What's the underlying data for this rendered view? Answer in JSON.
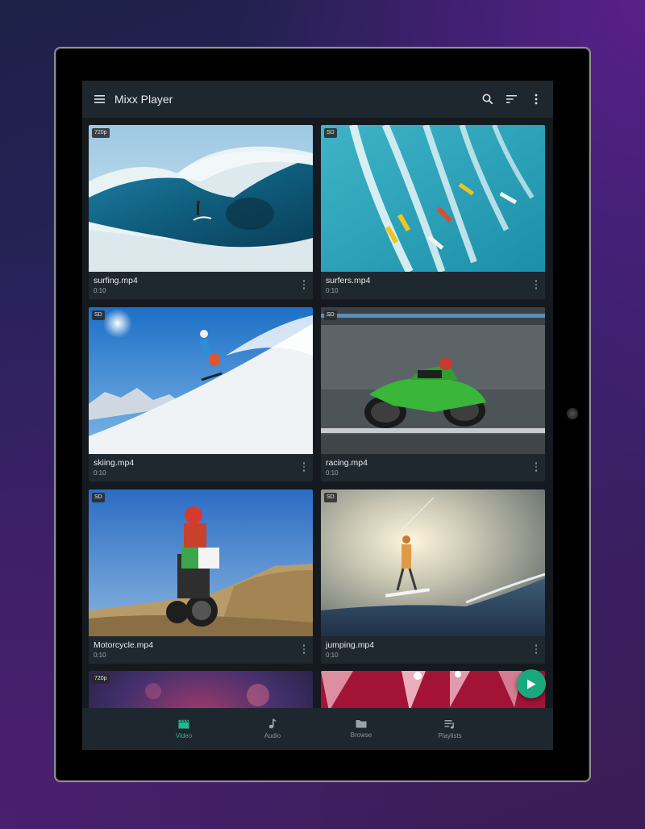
{
  "app": {
    "title": "Mixx Player"
  },
  "toolbar": {
    "icons": [
      "menu-icon",
      "search-icon",
      "sort-icon",
      "more-vert-icon"
    ]
  },
  "videos": [
    {
      "name": "surfing.mp4",
      "duration": "0:10",
      "quality": "720p",
      "scene": "wave"
    },
    {
      "name": "surfers.mp4",
      "duration": "0:10",
      "quality": "SD",
      "scene": "surfers"
    },
    {
      "name": "skiing.mp4",
      "duration": "0:10",
      "quality": "SD",
      "scene": "ski"
    },
    {
      "name": "racing.mp4",
      "duration": "0:10",
      "quality": "SD",
      "scene": "moto"
    },
    {
      "name": "Motorcycle.mp4",
      "duration": "0:10",
      "quality": "SD",
      "scene": "dirt"
    },
    {
      "name": "jumping.mp4",
      "duration": "0:10",
      "quality": "SD",
      "scene": "kite"
    },
    {
      "name": "",
      "duration": "",
      "quality": "720p",
      "scene": "concert"
    },
    {
      "name": "",
      "duration": "",
      "quality": "",
      "scene": "lights"
    }
  ],
  "bottom_nav": [
    {
      "label": "Video",
      "icon": "clapperboard-icon",
      "active": true
    },
    {
      "label": "Audio",
      "icon": "music-note-icon",
      "active": false
    },
    {
      "label": "Browse",
      "icon": "folder-icon",
      "active": false
    },
    {
      "label": "Playlists",
      "icon": "playlist-icon",
      "active": false
    }
  ],
  "colors": {
    "accent": "#21b98c",
    "toolbar": "#1f272e",
    "background": "#141a1f",
    "card": "#20282f"
  }
}
